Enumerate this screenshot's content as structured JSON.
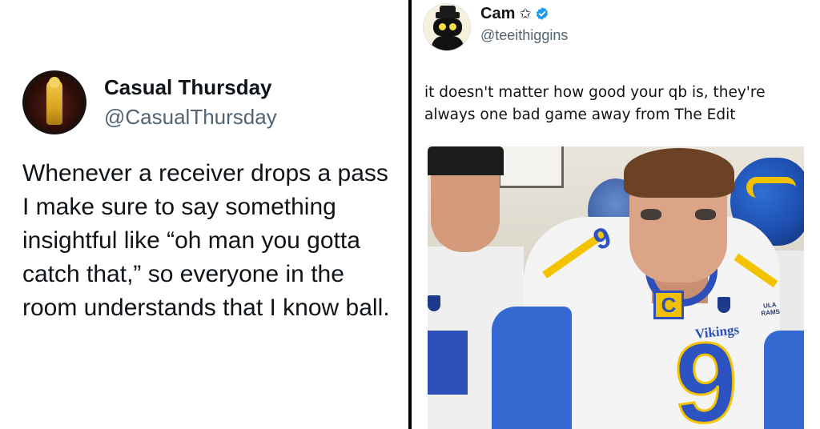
{
  "left_tweet": {
    "display_name": "Casual Thursday",
    "handle": "@CasualThursday",
    "text": "Whenever a receiver drops a pass I make sure to say something insightful like “oh man you gotta catch that,” so everyone in the room understands that I know ball."
  },
  "right_tweet": {
    "display_name": "Cam",
    "name_emoji": "✩",
    "verified_icon": "verified-badge-icon",
    "handle": "@teeithiggins",
    "text": "it doesn't matter how good your qb is, they're always one bad game away from The Edit",
    "photo": {
      "patch_letter": "C",
      "jersey_wordmark": "Vikings",
      "jersey_number": "9",
      "shoulder_number": "9",
      "tag_line1": "ULA",
      "tag_line2": "RAMS"
    }
  },
  "colors": {
    "text_primary": "#0f1419",
    "text_secondary": "#536471",
    "verified_blue": "#1d9bf0",
    "divider": "#000000"
  }
}
